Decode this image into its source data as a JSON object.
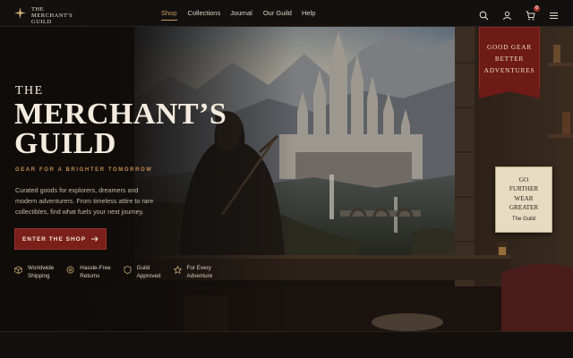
{
  "brand": {
    "line1": "THE",
    "line2": "MERCHANT'S",
    "line3": "GUILD"
  },
  "nav": {
    "items": [
      {
        "label": "Shop",
        "active": true
      },
      {
        "label": "Collections"
      },
      {
        "label": "Journal"
      },
      {
        "label": "Our Guild"
      },
      {
        "label": "Help"
      }
    ],
    "icons": [
      "search-icon",
      "account-icon",
      "cart-icon",
      "menu-icon"
    ],
    "cart_count": "0"
  },
  "hero": {
    "the": "THE",
    "title_line1": "MERCHANT’S",
    "title_line2": "GUILD",
    "tagline": "GEAR FOR A BRIGHTER TOMORROW",
    "description": "Curated goods for explorers, dreamers and modern adventurers. From timeless attire to rare collectibles, find what fuels your next journey.",
    "cta_label": "ENTER THE SHOP",
    "cta_icon": "arrow-right-icon"
  },
  "features": [
    {
      "line1": "Worldwide",
      "line2": "Shipping",
      "icon": "box-icon"
    },
    {
      "line1": "Hassle-Free",
      "line2": "Returns",
      "icon": "return-icon"
    },
    {
      "line1": "Guild",
      "line2": "Approved",
      "icon": "shield-icon"
    },
    {
      "line1": "For Every",
      "line2": "Adventure",
      "icon": "star-icon"
    }
  ],
  "banner": {
    "line1": "GOOD GEAR",
    "line2": "BETTER",
    "line3": "ADVENTURES"
  },
  "note": {
    "line1": "GO",
    "line2": "FURTHER",
    "line3": "WEAR",
    "line4": "GREATER",
    "signature": "The Guild"
  },
  "colors": {
    "accent": "#c89a5b",
    "cta": "#7a1f1a",
    "background": "#100d0b",
    "banner": "#6e1a17"
  }
}
